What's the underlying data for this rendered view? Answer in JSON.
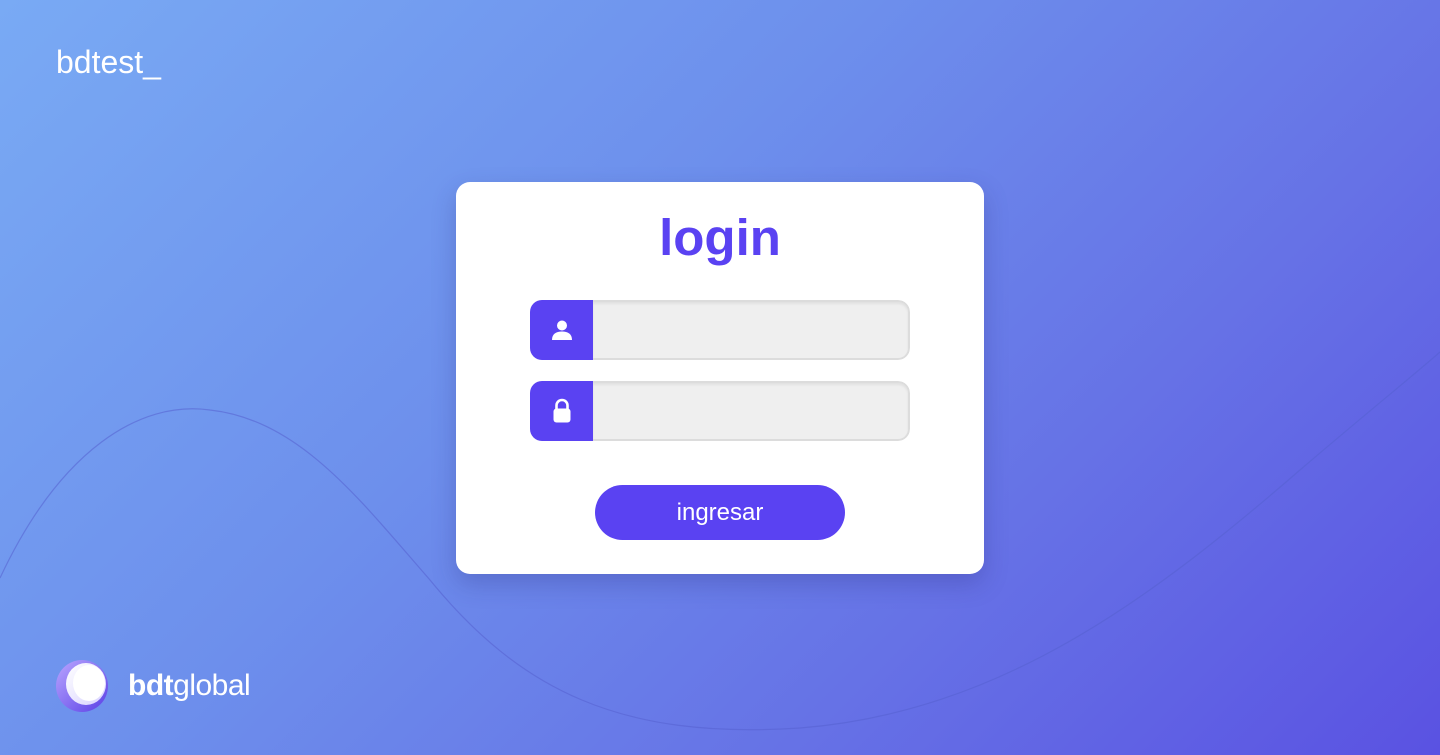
{
  "app": {
    "title": "bdtest_"
  },
  "login": {
    "title": "login",
    "username": {
      "icon": "user-icon",
      "value": "",
      "placeholder": ""
    },
    "password": {
      "icon": "lock-icon",
      "value": "",
      "placeholder": ""
    },
    "submit_label": "ingresar"
  },
  "brand": {
    "icon": "bdt-logo-icon",
    "name_strong": "bdt",
    "name_rest": "global"
  },
  "colors": {
    "accent": "#5a42f2",
    "background_start": "#79aaf4",
    "background_end": "#5a52e2",
    "card": "#ffffff",
    "field": "#efefef"
  }
}
